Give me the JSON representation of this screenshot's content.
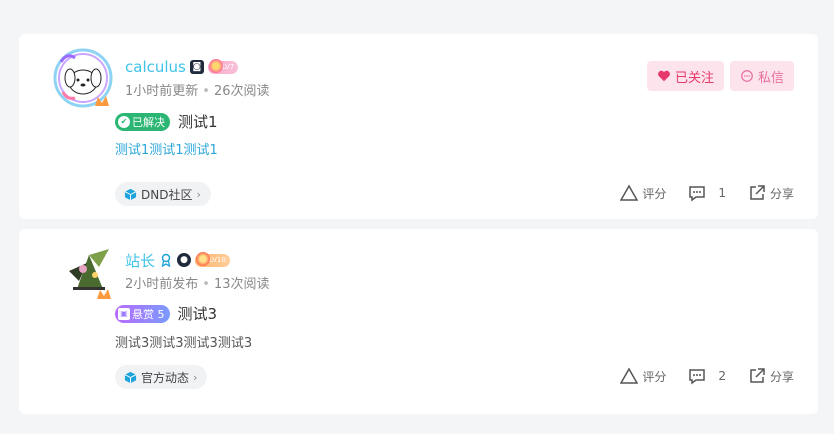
{
  "posts": [
    {
      "author": "calculus",
      "level": "LV7",
      "meta_time": "1小时前更新",
      "meta_views": "26次阅读",
      "status": "已解决",
      "title": "测试1",
      "excerpt": "测试1测试1测试1",
      "tag": "DND社区",
      "actions": {
        "rate": "评分",
        "comments": "1",
        "share": "分享"
      },
      "follow_label": "已关注",
      "message_label": "私信"
    },
    {
      "author": "站长",
      "level": "LV10",
      "meta_time": "2小时前发布",
      "meta_views": "13次阅读",
      "status": "悬赏 5",
      "title": "测试3",
      "excerpt": "测试3测试3测试3测试3",
      "tag": "官方动态",
      "actions": {
        "rate": "评分",
        "comments": "2",
        "share": "分享"
      }
    }
  ],
  "colors": {
    "author": "#3ec3e9",
    "solved": "#2bb673",
    "reward": "#9a7bff",
    "follow": "#e8396b",
    "tag_cube": "#1fa3dc"
  },
  "icons": [
    "level-badge-icon",
    "verified-icon",
    "medal-icon",
    "user-badge-icon",
    "check-icon",
    "gift-icon",
    "cube-icon",
    "chevron-right-icon",
    "rate-icon",
    "comment-icon",
    "share-icon",
    "heart-icon",
    "message-icon"
  ]
}
